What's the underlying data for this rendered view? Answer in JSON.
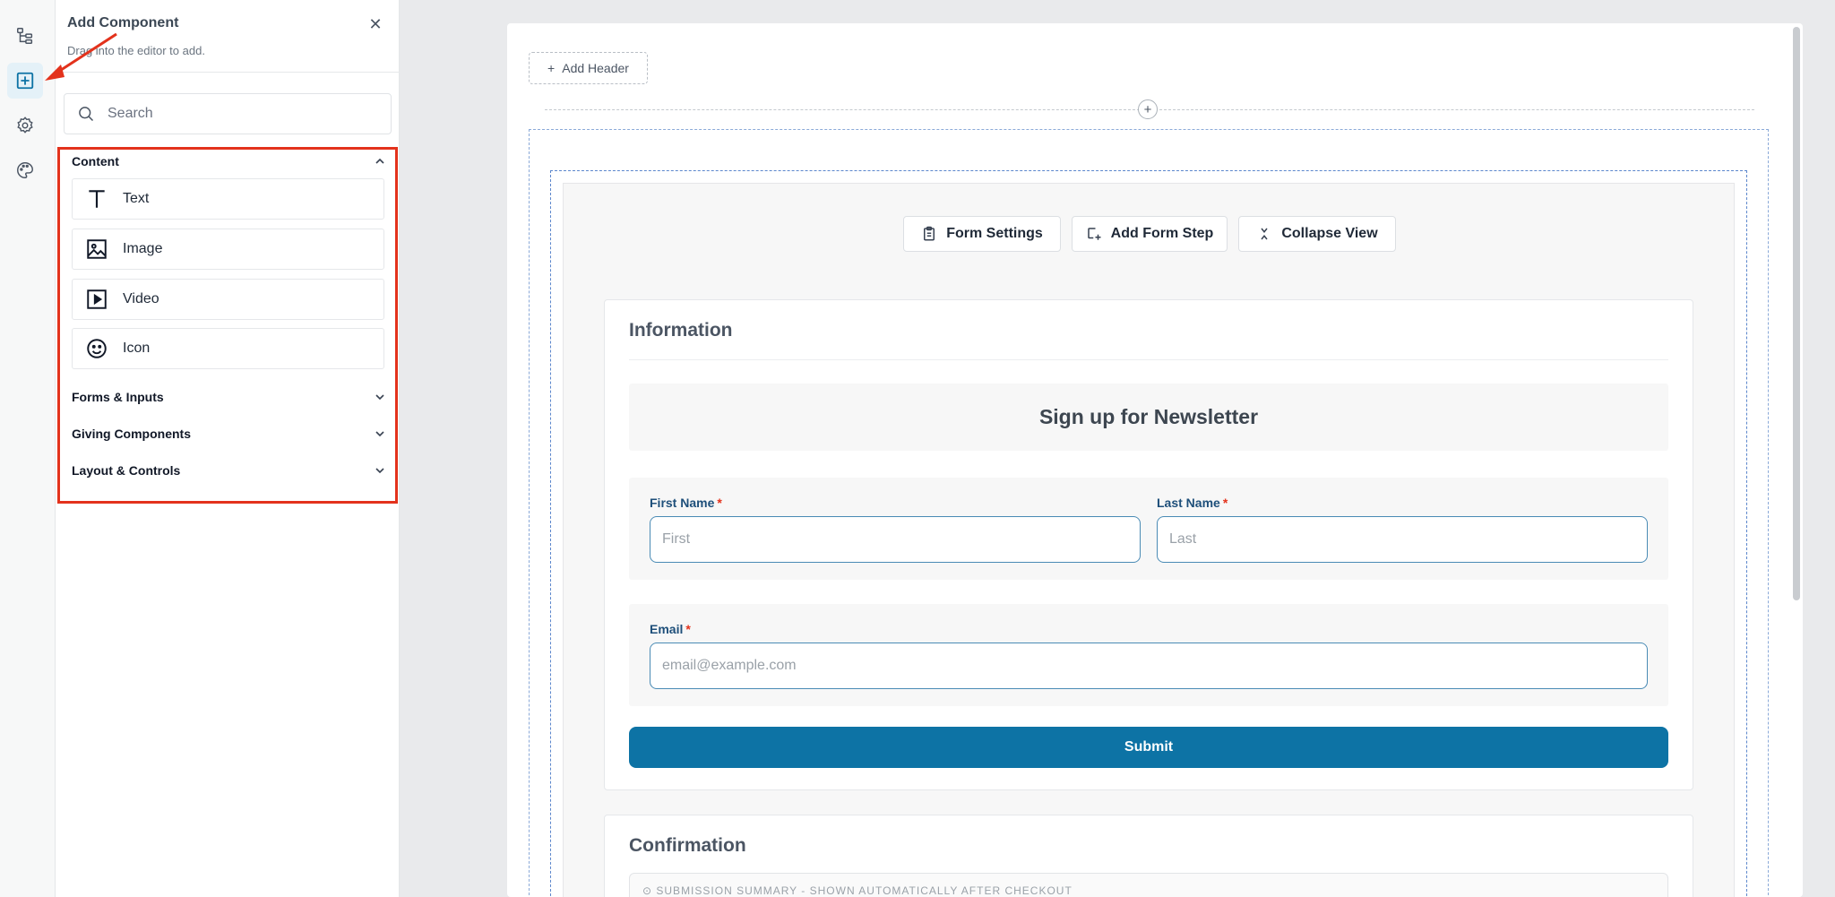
{
  "panel": {
    "title": "Add Component",
    "subtitle": "Drag into the editor to add.",
    "close_glyph": "✕",
    "search_placeholder": "Search"
  },
  "rail": {
    "items": [
      {
        "icon": "tree-structure-icon",
        "active": false
      },
      {
        "icon": "add-square-icon",
        "active": true
      },
      {
        "icon": "gear-icon",
        "active": false
      },
      {
        "icon": "palette-icon",
        "active": false
      }
    ]
  },
  "groups": {
    "content": {
      "label": "Content",
      "expanded": true,
      "items": [
        {
          "label": "Text",
          "icon": "text-icon"
        },
        {
          "label": "Image",
          "icon": "image-icon"
        },
        {
          "label": "Video",
          "icon": "video-icon"
        },
        {
          "label": "Icon",
          "icon": "smiley-icon"
        }
      ]
    },
    "forms": {
      "label": "Forms & Inputs",
      "expanded": false
    },
    "giving": {
      "label": "Giving Components",
      "expanded": false
    },
    "layout": {
      "label": "Layout & Controls",
      "expanded": false
    }
  },
  "canvas": {
    "add_header_label": "Add Header",
    "toolbar": {
      "form_settings": "Form Settings",
      "add_form_step": "Add Form Step",
      "collapse_view": "Collapse View"
    },
    "information": {
      "title": "Information",
      "newsletter_heading": "Sign up for Newsletter",
      "first_name": {
        "label": "First Name",
        "required_mark": "*",
        "placeholder": "First"
      },
      "last_name": {
        "label": "Last Name",
        "required_mark": "*",
        "placeholder": "Last"
      },
      "email": {
        "label": "Email",
        "required_mark": "*",
        "placeholder": "email@example.com"
      },
      "submit_label": "Submit"
    },
    "confirmation": {
      "title": "Confirmation",
      "summary_text": "⊙  SUBMISSION SUMMARY - SHOWN AUTOMATICALLY AFTER CHECKOUT"
    }
  },
  "colors": {
    "accent": "#0d73a5",
    "highlight_red": "#e3321c",
    "label_blue": "#1e4f7a",
    "dashed_blue": "#5b86cc"
  }
}
